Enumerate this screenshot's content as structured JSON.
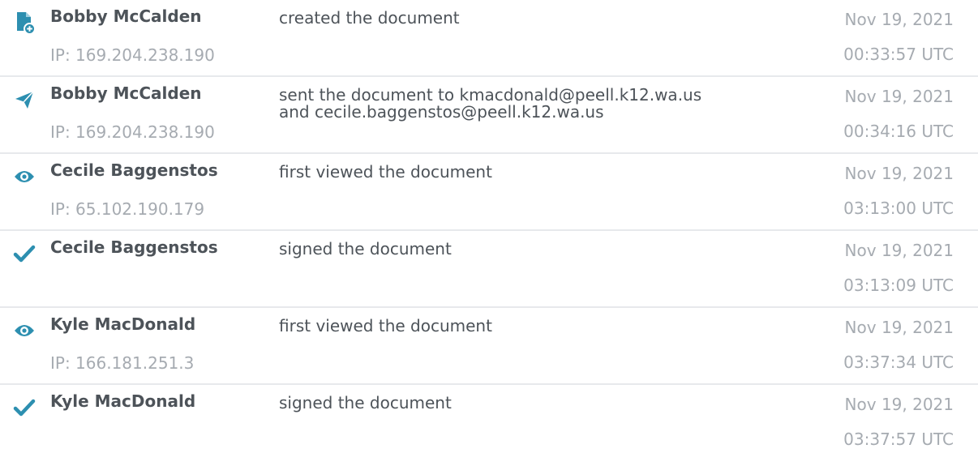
{
  "colors": {
    "icon": "#2d8fb0",
    "separator": "#e7e9ec",
    "muted": "#a6abb1",
    "text": "#4d5359"
  },
  "events": [
    {
      "icon": "document-add-icon",
      "actor": "Bobby McCalden",
      "ip": "IP: 169.204.238.190",
      "action": "created the document",
      "date": "Nov 19, 2021",
      "time": "00:33:57 UTC"
    },
    {
      "icon": "paper-plane-icon",
      "actor": "Bobby McCalden",
      "ip": "IP: 169.204.238.190",
      "action_line1": "sent the document to kmacdonald@peell.k12.wa.us",
      "action_line2": "and cecile.baggenstos@peell.k12.wa.us",
      "date": "Nov 19, 2021",
      "time": "00:34:16 UTC"
    },
    {
      "icon": "eye-icon",
      "actor": "Cecile Baggenstos",
      "ip": "IP: 65.102.190.179",
      "action": "first viewed the document",
      "date": "Nov 19, 2021",
      "time": "03:13:00 UTC"
    },
    {
      "icon": "checkmark-icon",
      "actor": "Cecile Baggenstos",
      "action": "signed the document",
      "date": "Nov 19, 2021",
      "time": "03:13:09 UTC"
    },
    {
      "icon": "eye-icon",
      "actor": "Kyle MacDonald",
      "ip": "IP: 166.181.251.3",
      "action": "first viewed the document",
      "date": "Nov 19, 2021",
      "time": "03:37:34 UTC"
    },
    {
      "icon": "checkmark-icon",
      "actor": "Kyle MacDonald",
      "action": "signed the document",
      "date": "Nov 19, 2021",
      "time": "03:37:57 UTC"
    }
  ]
}
